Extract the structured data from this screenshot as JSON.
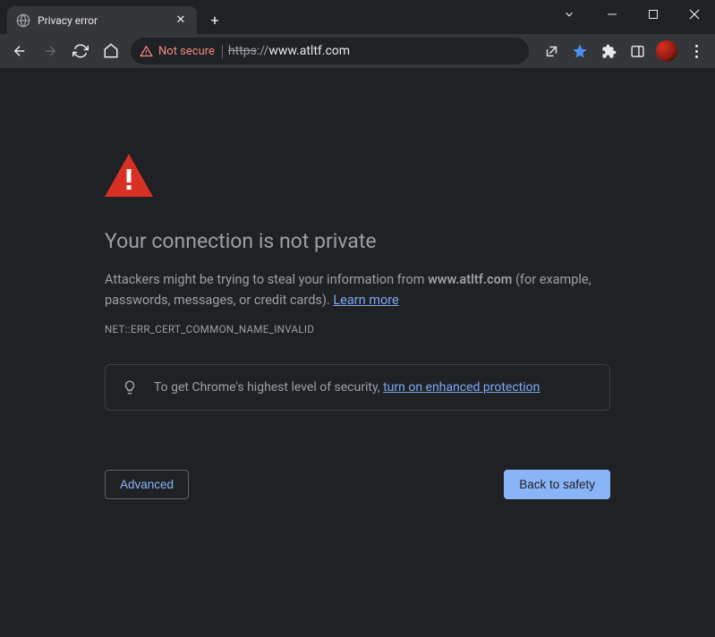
{
  "tab": {
    "title": "Privacy error"
  },
  "omnibox": {
    "security_label": "Not secure",
    "protocol": "https",
    "sep": "://",
    "domain": "www.atltf.com"
  },
  "page": {
    "heading": "Your connection is not private",
    "body_prefix": "Attackers might be trying to steal your information from ",
    "domain": "www.atltf.com",
    "body_suffix": " (for example, passwords, messages, or credit cards). ",
    "learn_more": "Learn more",
    "error_code": "NET::ERR_CERT_COMMON_NAME_INVALID",
    "enhanced_prefix": "To get Chrome's highest level of security, ",
    "enhanced_link": "turn on enhanced protection",
    "advanced": "Advanced",
    "back_to_safety": "Back to safety"
  }
}
